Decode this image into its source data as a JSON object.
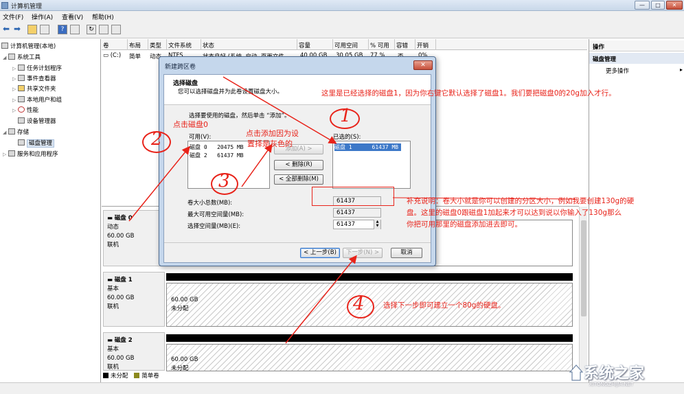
{
  "window": {
    "title": "计算机管理",
    "buttons": {
      "min": "—",
      "max": "□",
      "close": "✕"
    }
  },
  "menu": {
    "file": "文件(F)",
    "action": "操作(A)",
    "view": "查看(V)",
    "help": "帮助(H)"
  },
  "tree": {
    "root": "计算机管理(本地)",
    "system_tools": "系统工具",
    "task_scheduler": "任务计划程序",
    "event_viewer": "事件查看器",
    "shared_folders": "共享文件夹",
    "local_users": "本地用户和组",
    "performance": "性能",
    "device_manager": "设备管理器",
    "storage": "存储",
    "disk_management": "磁盘管理",
    "services": "服务和应用程序"
  },
  "volume_table": {
    "columns": [
      "卷",
      "布局",
      "类型",
      "文件系统",
      "状态",
      "容量",
      "可用空间",
      "% 可用",
      "容错",
      "开销"
    ],
    "row": [
      "(C:)",
      "简单",
      "动态",
      "NTFS",
      "状态良好 (系统, 启动, 页面文件",
      "40.00 GB",
      "30.05 GB",
      "77 %",
      "否",
      "0%"
    ]
  },
  "disks": [
    {
      "name": "磁盘 0",
      "type": "动态",
      "size": "60.00 GB",
      "status": "联机"
    },
    {
      "name": "磁盘 1",
      "type": "基本",
      "size": "60.00 GB",
      "status": "联机",
      "part_size": "60.00 GB",
      "part_status": "未分配"
    },
    {
      "name": "磁盘 2",
      "type": "基本",
      "size": "60.00 GB",
      "status": "联机",
      "part_size": "60.00 GB",
      "part_status": "未分配"
    }
  ],
  "legend": {
    "unallocated": "未分配",
    "simple": "简单卷",
    "unallocated_color": "#000000",
    "simple_color": "#8c8a1e"
  },
  "actions": {
    "header": "操作",
    "section": "磁盘管理",
    "more": "更多操作"
  },
  "dialog": {
    "title": "新建跨区卷",
    "close": "✕",
    "heading": "选择磁盘",
    "subheading": "您可以选择磁盘并为此卷设置磁盘大小。",
    "instruction": "选择要使用的磁盘，然后单击 “添加”。",
    "available_label": "可用(V):",
    "available": [
      {
        "name": "磁盘 0",
        "size": "20475 MB"
      },
      {
        "name": "磁盘 2",
        "size": "61437 MB"
      }
    ],
    "selected_label": "已选的(S):",
    "selected": [
      {
        "name": "磁盘 1",
        "size": "61437 MB"
      }
    ],
    "add_btn": "添加(A) >",
    "remove_btn": "< 删除(R)",
    "remove_all_btn": "< 全部删除(M)",
    "total_label": "卷大小总数(MB):",
    "total_value": "61437",
    "max_label": "最大可用空间量(MB):",
    "max_value": "61437",
    "select_label": "选择空间量(MB)(E):",
    "select_value": "61437",
    "back_btn": "< 上一步(B)",
    "next_btn": "下一步(N) >",
    "cancel_btn": "取消"
  },
  "annotations": {
    "num1": "1",
    "num2": "2",
    "num3": "3",
    "num4": "4",
    "top_note": "这里是已经选择的磁盘1，因为你右键它默认选择了磁盘1。我们要把磁盘0的20g加入才行。",
    "click_disk0": "点击磁盘0",
    "click_add_1": "点击添加因为设",
    "click_add_2": "置择是灰色的",
    "extra_1": "补充说明：卷大小就是你可以创建的分区大小，例如我要创建130g的硬",
    "extra_2": "盘。这里的磁盘0跟磁盘1加起来才可以达到说以你输入了130g那么",
    "extra_3": "你把可用那里的磁盘添加进去即可。",
    "next_note": "选择下一步即可建立一个80g的硬盘。",
    "color": "#e8231a"
  },
  "watermark": {
    "text": "系统之家",
    "sub": "XITONGZHIJIA.NET"
  }
}
